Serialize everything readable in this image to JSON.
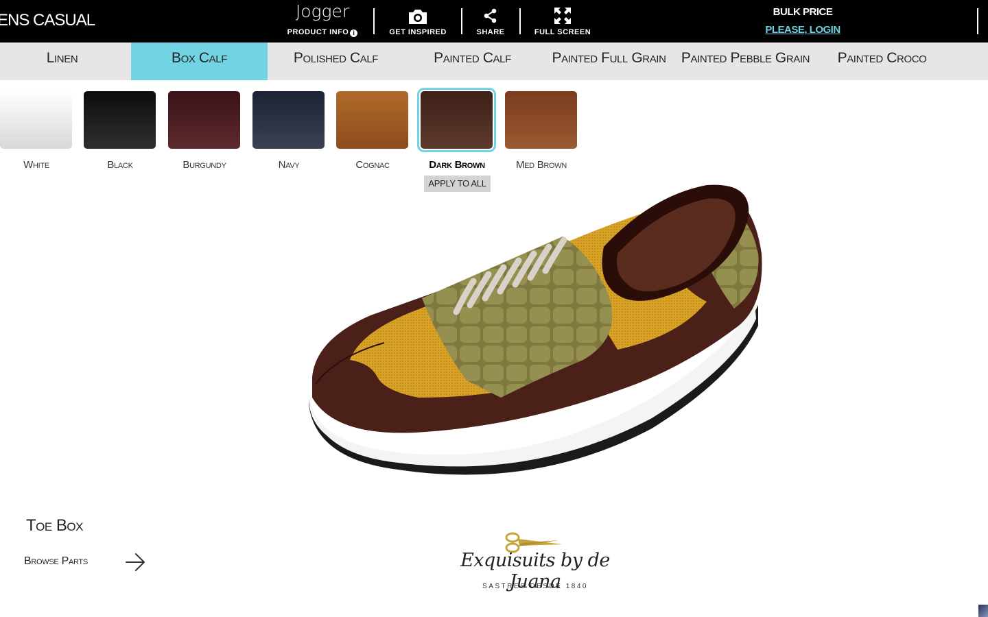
{
  "header": {
    "collection": "ENS CASUAL",
    "product_name": "Jogger",
    "product_info_label": "PRODUCT INFO",
    "get_inspired_label": "GET INSPIRED",
    "share_label": "SHARE",
    "full_screen_label": "FULL SCREEN",
    "bulk_price_label": "BULK PRICE",
    "login_link": "PLEASE, LOGIN"
  },
  "material_tabs": [
    {
      "label": "Linen",
      "active": false
    },
    {
      "label": "Box Calf",
      "active": true
    },
    {
      "label": "Polished Calf",
      "active": false
    },
    {
      "label": "Painted Calf",
      "active": false
    },
    {
      "label": "Painted Full Grain",
      "active": false
    },
    {
      "label": "Painted Pebble Grain",
      "active": false
    },
    {
      "label": "Painted Croco",
      "active": false
    }
  ],
  "swatches": [
    {
      "label": "White",
      "color": "#ececec",
      "selected": false
    },
    {
      "label": "Black",
      "color": "#141414",
      "selected": false
    },
    {
      "label": "Burgundy",
      "color": "#4a1d22",
      "selected": false
    },
    {
      "label": "Navy",
      "color": "#222a3c",
      "selected": false
    },
    {
      "label": "Cognac",
      "color": "#a55e22",
      "selected": false
    },
    {
      "label": "Dark Brown",
      "color": "#4b2a20",
      "selected": true
    },
    {
      "label": "Med Brown",
      "color": "#8a4a27",
      "selected": false
    }
  ],
  "apply_to_all_label": "APPLY TO ALL",
  "part": {
    "current": "Toe Box",
    "browse_label": "Browse Parts"
  },
  "logo": {
    "script": "Exquisuits by de Juana",
    "tagline": "SASTRES DESDE 1840"
  },
  "colors": {
    "accent": "#72d3e2",
    "topbar": "#000000",
    "tabs_bg": "#e6e6e6"
  }
}
